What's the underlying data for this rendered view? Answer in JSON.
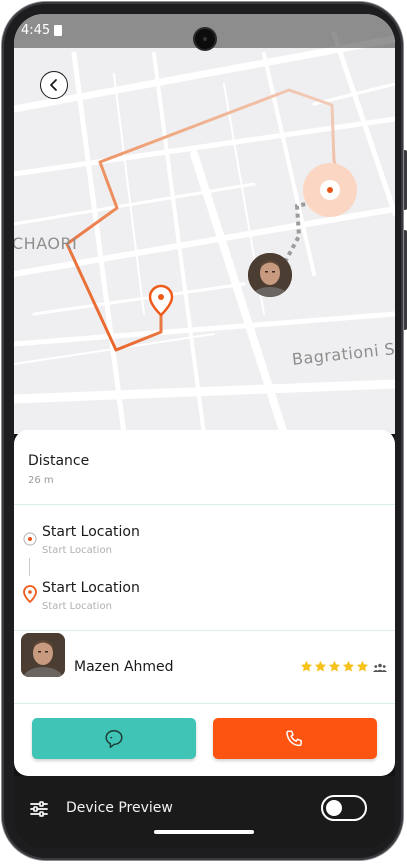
{
  "status_bar": {
    "time": "4:45"
  },
  "map": {
    "street_label": "Bagrationi S",
    "district_label": "CHAORI",
    "route_color": "#f06a2a",
    "destination_color": "#f06a2a"
  },
  "trip": {
    "distance_label": "Distance",
    "distance_value": "26 m",
    "pickup": {
      "title": "Start Location",
      "subtitle": "Start Location"
    },
    "dropoff": {
      "title": "Start Location",
      "subtitle": "Start Location"
    }
  },
  "driver": {
    "name": "Mazen Ahmed",
    "rating": 5,
    "rating_max": 5
  },
  "actions": {
    "chat_icon": "chat-bubble-icon",
    "call_icon": "phone-icon",
    "chat_color": "#3fc4b5",
    "call_color": "#fd5412"
  },
  "device_preview": {
    "label": "Device Preview",
    "toggle_on": false
  }
}
